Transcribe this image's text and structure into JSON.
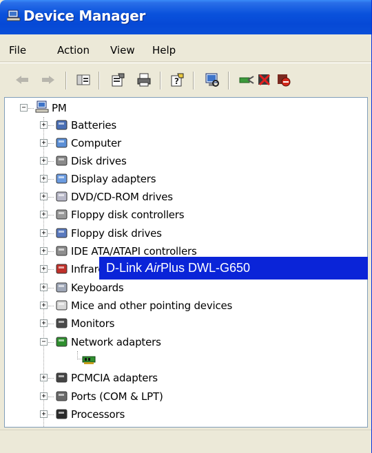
{
  "window": {
    "title": "Device Manager"
  },
  "menu": [
    "File",
    "Action",
    "View",
    "Help"
  ],
  "toolbar": {
    "buttons": [
      "back-icon",
      "forward-icon",
      "show-hide-console-tree-icon",
      "properties-icon",
      "print-icon",
      "help-icon",
      "scan-hardware-icon",
      "update-driver-icon",
      "uninstall-icon",
      "disable-icon"
    ]
  },
  "tree": {
    "root": "PM",
    "categories": [
      "Batteries",
      "Computer",
      "Disk drives",
      "Display adapters",
      "DVD/CD-ROM drives",
      "Floppy disk controllers",
      "Floppy disk drives",
      "IDE ATA/ATAPI controllers",
      "Infrared devices",
      "Keyboards",
      "Mice and other pointing devices",
      "Monitors",
      "Network adapters",
      "PCMCIA adapters",
      "Ports (COM & LPT)",
      "Processors"
    ],
    "network_child": "D-Link AirPlus DWL-G650",
    "network_child_parts": {
      "pre": "D-Link ",
      "italic": "Air",
      "post": "Plus DWL-G650"
    }
  },
  "colors": {
    "titlebar": "#0a52dc",
    "selection": "#0a24d8",
    "chrome": "#ece9d8"
  }
}
